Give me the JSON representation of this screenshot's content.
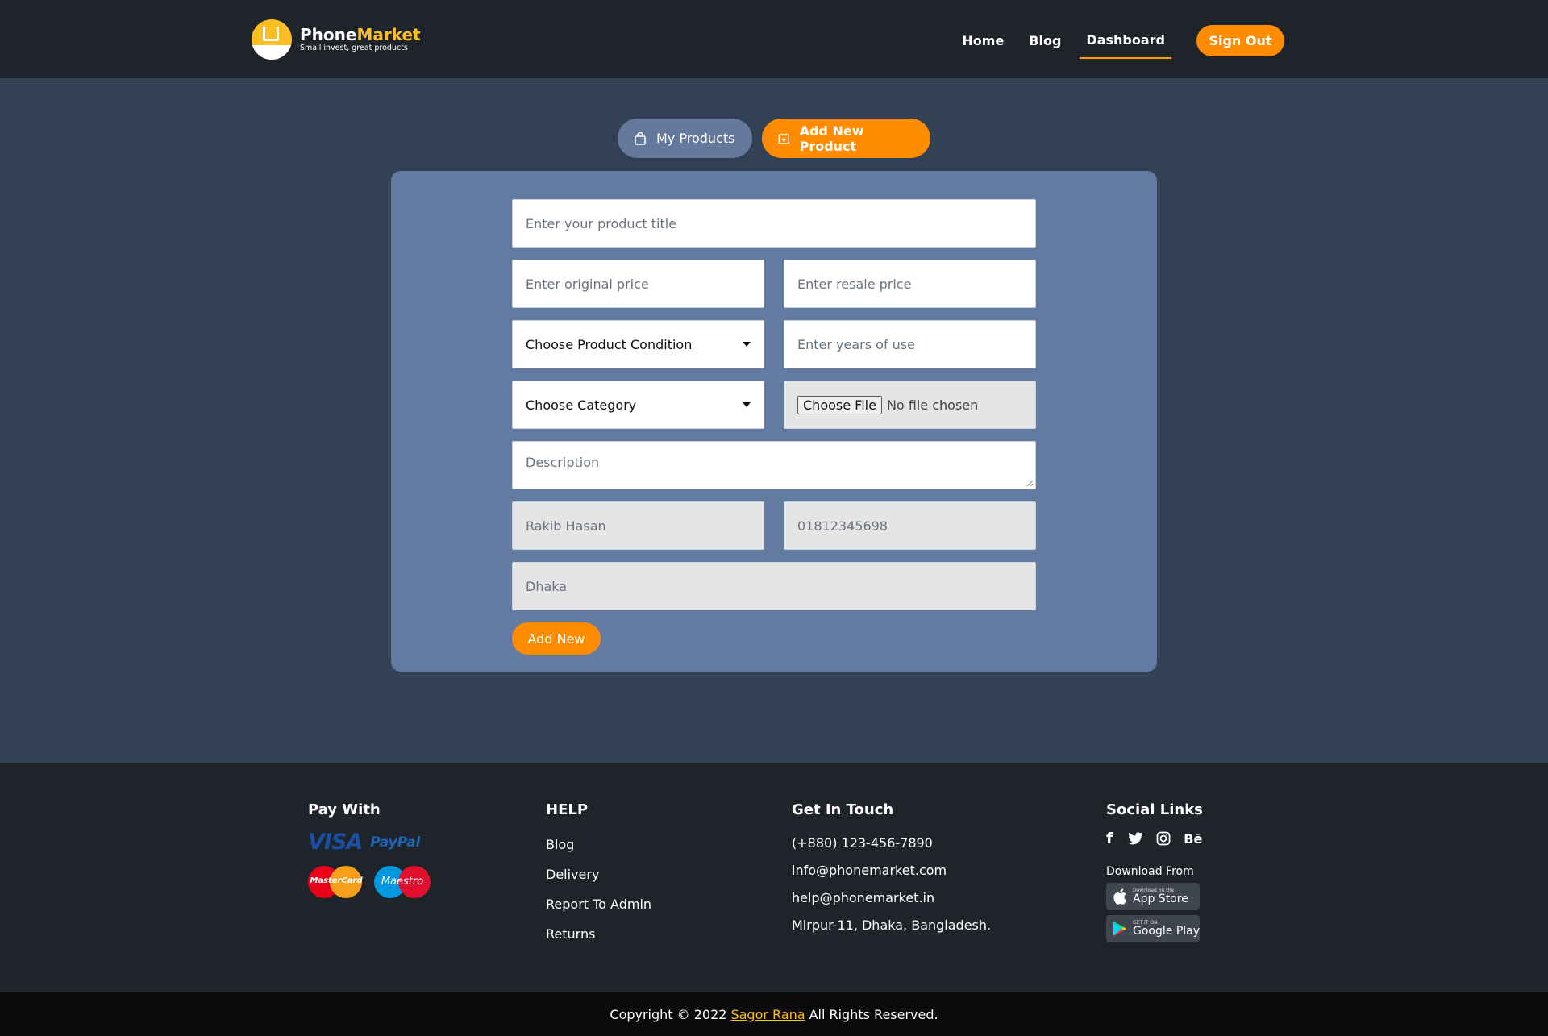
{
  "header": {
    "brand_part1": "Phone",
    "brand_part2": "Market",
    "tagline": "Small invest, great products",
    "nav": [
      "Home",
      "Blog",
      "Dashboard"
    ],
    "active_nav": "Dashboard",
    "signout_label": "Sign Out"
  },
  "tabs": {
    "my_products": "My Products",
    "add_new_product": "Add New Product"
  },
  "form": {
    "title_placeholder": "Enter your product title",
    "original_price_placeholder": "Enter original price",
    "resale_price_placeholder": "Enter resale price",
    "condition_select": "Choose Product Condition",
    "years_placeholder": "Enter years of use",
    "category_select": "Choose Category",
    "file_button": "Choose File",
    "file_status": "No file chosen",
    "description_placeholder": "Description",
    "seller_name": "Rakib Hasan",
    "phone": "01812345698",
    "location": "Dhaka",
    "submit_label": "Add New"
  },
  "footer": {
    "pay_title": "Pay With",
    "visa": "VISA",
    "paypal": "PayPal",
    "mastercard": "MasterCard",
    "maestro": "Maestro",
    "help_title": "HELP",
    "help_links": [
      "Blog",
      "Delivery",
      "Report To Admin",
      "Returns"
    ],
    "contact_title": "Get In Touch",
    "contact": [
      "(+880) 123-456-7890",
      "info@phonemarket.com",
      "help@phonemarket.in",
      "Mirpur-11, Dhaka, Bangladesh."
    ],
    "social_title": "Social Links",
    "social_icons": [
      "facebook-icon",
      "twitter-icon",
      "instagram-icon",
      "behance-icon"
    ],
    "download_title": "Download From",
    "appstore_small": "Download on the",
    "appstore_big": "App Store",
    "googleplay_small": "GET IT ON",
    "googleplay_big": "Google Play"
  },
  "copyright": {
    "prefix": "Copyright © 2022",
    "author": "Sagor Rana",
    "suffix": "All Rights Reserved."
  },
  "colors": {
    "accent": "#ff8c00",
    "brand_yellow": "#fbbf24",
    "header_bg": "#1f242b",
    "page_bg": "#334155",
    "card_bg": "#637ba1"
  }
}
